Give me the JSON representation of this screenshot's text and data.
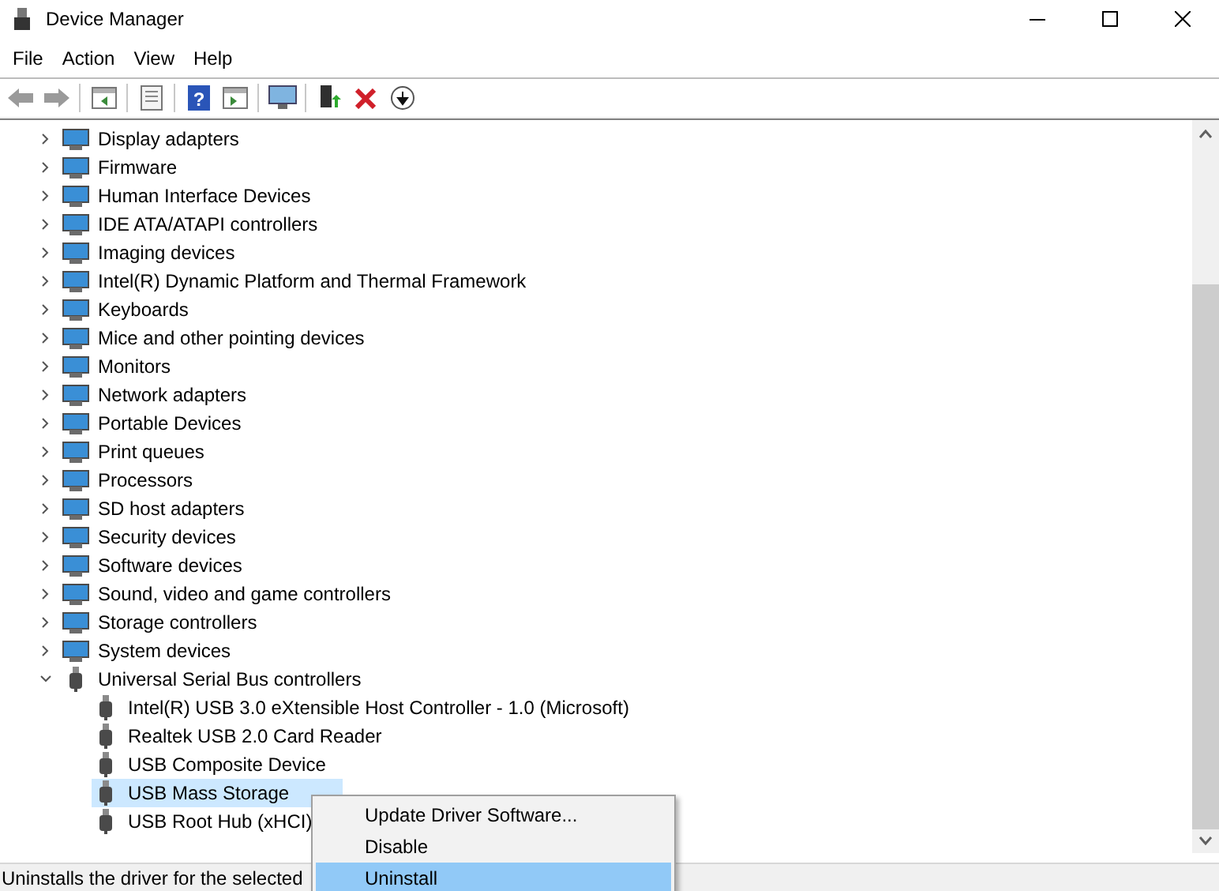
{
  "window": {
    "title": "Device Manager"
  },
  "menu": [
    "File",
    "Action",
    "View",
    "Help"
  ],
  "tree": {
    "items": [
      {
        "label": "Display adapters",
        "expanded": false,
        "selected": false
      },
      {
        "label": "Firmware",
        "expanded": false,
        "selected": false
      },
      {
        "label": "Human Interface Devices",
        "expanded": false,
        "selected": false
      },
      {
        "label": "IDE ATA/ATAPI controllers",
        "expanded": false,
        "selected": false
      },
      {
        "label": "Imaging devices",
        "expanded": false,
        "selected": false
      },
      {
        "label": "Intel(R) Dynamic Platform and Thermal Framework",
        "expanded": false,
        "selected": false
      },
      {
        "label": "Keyboards",
        "expanded": false,
        "selected": false
      },
      {
        "label": "Mice and other pointing devices",
        "expanded": false,
        "selected": false
      },
      {
        "label": "Monitors",
        "expanded": false,
        "selected": false
      },
      {
        "label": "Network adapters",
        "expanded": false,
        "selected": false
      },
      {
        "label": "Portable Devices",
        "expanded": false,
        "selected": false
      },
      {
        "label": "Print queues",
        "expanded": false,
        "selected": false
      },
      {
        "label": "Processors",
        "expanded": false,
        "selected": false
      },
      {
        "label": "SD host adapters",
        "expanded": false,
        "selected": false
      },
      {
        "label": "Security devices",
        "expanded": false,
        "selected": false
      },
      {
        "label": "Software devices",
        "expanded": false,
        "selected": false
      },
      {
        "label": "Sound, video and game controllers",
        "expanded": false,
        "selected": false
      },
      {
        "label": "Storage controllers",
        "expanded": false,
        "selected": false
      },
      {
        "label": "System devices",
        "expanded": false,
        "selected": false
      },
      {
        "label": "Universal Serial Bus controllers",
        "expanded": true,
        "selected": false,
        "children": [
          {
            "label": "Intel(R) USB 3.0 eXtensible Host Controller - 1.0 (Microsoft)",
            "selected": false
          },
          {
            "label": "Realtek USB 2.0 Card Reader",
            "selected": false
          },
          {
            "label": "USB Composite Device",
            "selected": false
          },
          {
            "label": "USB Mass Storage",
            "selected": true
          },
          {
            "label": "USB Root Hub (xHCI)",
            "selected": false
          }
        ]
      }
    ]
  },
  "context_menu": [
    {
      "label": "Update Driver Software...",
      "selected": false
    },
    {
      "label": "Disable",
      "selected": false
    },
    {
      "label": "Uninstall",
      "selected": true
    }
  ],
  "status_bar": "Uninstalls the driver for the selected",
  "toolbar": {
    "help_glyph": "?"
  }
}
